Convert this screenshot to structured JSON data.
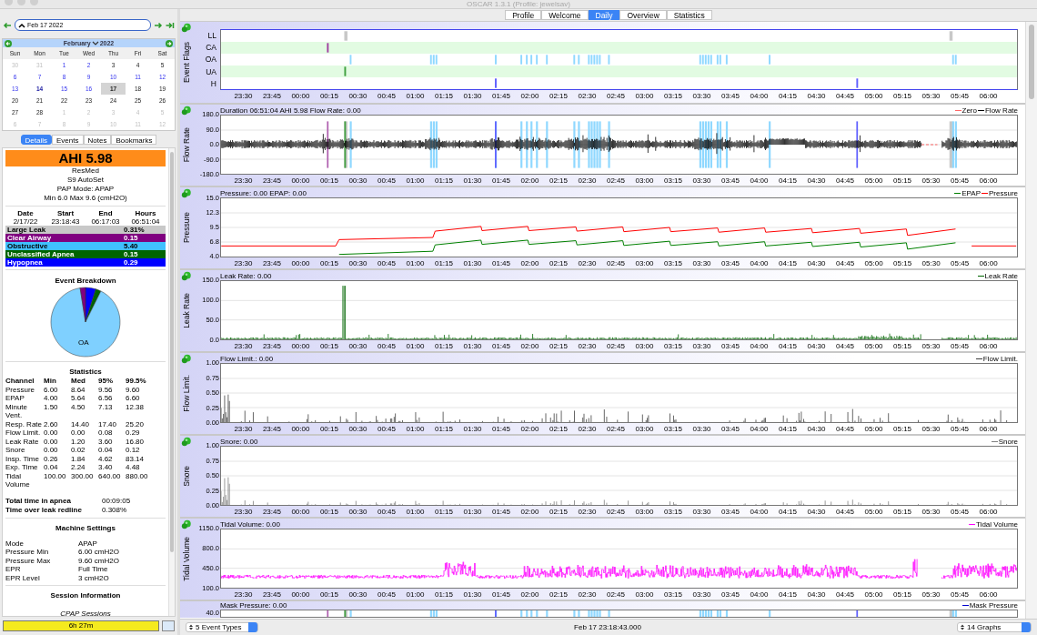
{
  "window": {
    "title": "OSCAR 1.3.1 (Profile: jewelsav)"
  },
  "date_field": {
    "value": "Feb 17 2022"
  },
  "calendar": {
    "month": "February",
    "year": "2022",
    "weekdays": [
      "Sun",
      "Mon",
      "Tue",
      "Wed",
      "Thu",
      "Fri",
      "Sat"
    ],
    "weeks": [
      [
        {
          "day": "30",
          "kind": "other",
          "selected": false
        },
        {
          "day": "31",
          "kind": "other",
          "selected": false
        },
        {
          "day": "1",
          "kind": "data",
          "selected": false
        },
        {
          "day": "2",
          "kind": "data",
          "selected": false
        },
        {
          "day": "3",
          "kind": "plain",
          "selected": false
        },
        {
          "day": "4",
          "kind": "plain",
          "selected": false
        },
        {
          "day": "5",
          "kind": "plain",
          "selected": false
        }
      ],
      [
        {
          "day": "6",
          "kind": "data",
          "selected": false
        },
        {
          "day": "7",
          "kind": "data",
          "selected": false
        },
        {
          "day": "8",
          "kind": "data",
          "selected": false
        },
        {
          "day": "9",
          "kind": "data",
          "selected": false
        },
        {
          "day": "10",
          "kind": "data",
          "selected": false
        },
        {
          "day": "11",
          "kind": "data",
          "selected": false
        },
        {
          "day": "12",
          "kind": "data",
          "selected": false
        }
      ],
      [
        {
          "day": "13",
          "kind": "data",
          "selected": false
        },
        {
          "day": "14",
          "kind": "today",
          "selected": false
        },
        {
          "day": "15",
          "kind": "data",
          "selected": false
        },
        {
          "day": "16",
          "kind": "data",
          "selected": false
        },
        {
          "day": "17",
          "kind": "plain",
          "selected": true
        },
        {
          "day": "18",
          "kind": "plain",
          "selected": false
        },
        {
          "day": "19",
          "kind": "plain",
          "selected": false
        }
      ],
      [
        {
          "day": "20",
          "kind": "plain",
          "selected": false
        },
        {
          "day": "21",
          "kind": "plain",
          "selected": false
        },
        {
          "day": "22",
          "kind": "plain",
          "selected": false
        },
        {
          "day": "23",
          "kind": "plain",
          "selected": false
        },
        {
          "day": "24",
          "kind": "plain",
          "selected": false
        },
        {
          "day": "25",
          "kind": "plain",
          "selected": false
        },
        {
          "day": "26",
          "kind": "plain",
          "selected": false
        }
      ],
      [
        {
          "day": "27",
          "kind": "plain",
          "selected": false
        },
        {
          "day": "28",
          "kind": "plain",
          "selected": false
        },
        {
          "day": "1",
          "kind": "other",
          "selected": false
        },
        {
          "day": "2",
          "kind": "other",
          "selected": false
        },
        {
          "day": "3",
          "kind": "other",
          "selected": false
        },
        {
          "day": "4",
          "kind": "other",
          "selected": false
        },
        {
          "day": "5",
          "kind": "other",
          "selected": false
        }
      ],
      [
        {
          "day": "6",
          "kind": "other",
          "selected": false
        },
        {
          "day": "7",
          "kind": "other",
          "selected": false
        },
        {
          "day": "8",
          "kind": "other",
          "selected": false
        },
        {
          "day": "9",
          "kind": "other",
          "selected": false
        },
        {
          "day": "10",
          "kind": "other",
          "selected": false
        },
        {
          "day": "11",
          "kind": "other",
          "selected": false
        },
        {
          "day": "12",
          "kind": "other",
          "selected": false
        }
      ]
    ]
  },
  "side_tabs": [
    {
      "label": "Details",
      "selected": true
    },
    {
      "label": "Events",
      "selected": false
    },
    {
      "label": "Notes",
      "selected": false
    },
    {
      "label": "Bookmarks",
      "selected": false
    }
  ],
  "summary": {
    "ahi": "AHI 5.98",
    "lines": [
      "ResMed",
      "S9 AutoSet",
      "PAP Mode: APAP",
      "Min 6.0 Max 9.6 (cmH2O)"
    ]
  },
  "session": {
    "headers": [
      "Date",
      "Start",
      "End",
      "Hours"
    ],
    "values": [
      "2/17/22",
      "23:18:43",
      "06:17:03",
      "06:51:04"
    ]
  },
  "events": [
    {
      "name": "Large Leak",
      "value": "0.31%",
      "color": "#c8c8c8",
      "kind": "leak"
    },
    {
      "name": "Clear Airway",
      "value": "0.15",
      "color": "#800080",
      "kind": "apnea"
    },
    {
      "name": "Obstructive",
      "value": "5.40",
      "color": "#40c0ff",
      "kind": "apnea"
    },
    {
      "name": "Unclassified Apnea",
      "value": "0.15",
      "color": "#006400",
      "kind": "apnea"
    },
    {
      "name": "Hypopnea",
      "value": "0.29",
      "color": "#0000ff",
      "kind": "apnea"
    }
  ],
  "breakdown": {
    "title": "Event Breakdown",
    "label": "OA"
  },
  "statistics": {
    "title": "Statistics",
    "columns": [
      "Channel",
      "Min",
      "Med",
      "95%",
      "99.5%"
    ],
    "rows": [
      [
        "Pressure",
        "6.00",
        "8.64",
        "9.56",
        "9.60"
      ],
      [
        "EPAP",
        "4.00",
        "5.64",
        "6.56",
        "6.60"
      ],
      [
        "Minute Vent.",
        "1.50",
        "4.50",
        "7.13",
        "12.38"
      ],
      [
        "Resp. Rate",
        "2.60",
        "14.40",
        "17.40",
        "25.20"
      ],
      [
        "Flow Limit.",
        "0.00",
        "0.00",
        "0.08",
        "0.29"
      ],
      [
        "Leak Rate",
        "0.00",
        "1.20",
        "3.60",
        "16.80"
      ],
      [
        "Snore",
        "0.00",
        "0.02",
        "0.04",
        "0.12"
      ],
      [
        "Insp. Time",
        "0.26",
        "1.84",
        "4.62",
        "83.14"
      ],
      [
        "Exp. Time",
        "0.04",
        "2.24",
        "3.40",
        "4.48"
      ],
      [
        "Tidal Volume",
        "100.00",
        "300.00",
        "640.00",
        "880.00"
      ]
    ]
  },
  "totals": [
    {
      "label": "Total time in apnea",
      "value": "00:09:05"
    },
    {
      "label": "Time over leak redline",
      "value": "0.308%"
    }
  ],
  "machine_settings": {
    "title": "Machine Settings",
    "rows": [
      {
        "label": "Mode",
        "value": "APAP"
      },
      {
        "label": "Pressure Min",
        "value": "6.00 cmH2O"
      },
      {
        "label": "Pressure Max",
        "value": "9.60 cmH2O"
      },
      {
        "label": "EPR",
        "value": "Full Time"
      },
      {
        "label": "EPR Level",
        "value": "3 cmH2O"
      }
    ]
  },
  "session_info": {
    "title": "Session Information",
    "subtitle": "CPAP Sessions"
  },
  "usage_bar": {
    "label": "6h 27m"
  },
  "main_tabs": [
    {
      "label": "Profile",
      "selected": false
    },
    {
      "label": "Welcome",
      "selected": false
    },
    {
      "label": "Daily",
      "selected": true
    },
    {
      "label": "Overview",
      "selected": false
    },
    {
      "label": "Statistics",
      "selected": false
    }
  ],
  "graphs": [
    {
      "kind": "flags",
      "ylabel": "Event Flags",
      "rows": [
        "LL",
        "CA",
        "OA",
        "UA",
        "H"
      ],
      "xticks": [
        "23:30",
        "23:45",
        "00:00",
        "00:15",
        "00:30",
        "00:45",
        "01:00",
        "01:15",
        "01:30",
        "01:45",
        "02:00",
        "02:15",
        "02:30",
        "02:45",
        "03:00",
        "03:15",
        "03:30",
        "03:45",
        "04:00",
        "04:15",
        "04:30",
        "04:45",
        "05:00",
        "05:15",
        "05:30",
        "05:45",
        "06:00"
      ]
    },
    {
      "kind": "flow",
      "ylabel": "Flow Rate",
      "title": "Duration 06:51:04 AHI 5.98 Flow Rate: 0.00",
      "legend": [
        {
          "label": "Zero",
          "color": "#ff6666"
        },
        {
          "label": "Flow Rate",
          "color": "#000000"
        }
      ],
      "yticks": [
        "180.0",
        "90.0",
        "0.0",
        "-90.0",
        "-180.0"
      ],
      "xticks": [
        "23:30",
        "23:45",
        "00:00",
        "00:15",
        "00:30",
        "00:45",
        "01:00",
        "01:15",
        "01:30",
        "01:45",
        "02:00",
        "02:15",
        "02:30",
        "02:45",
        "03:00",
        "03:15",
        "03:30",
        "03:45",
        "04:00",
        "04:15",
        "04:30",
        "04:45",
        "05:00",
        "05:15",
        "05:30",
        "05:45",
        "06:00"
      ]
    },
    {
      "kind": "pressure",
      "ylabel": "Pressure",
      "title": "Pressure: 0.00 EPAP: 0.00",
      "chart_data": {
        "type": "line",
        "grid": true,
        "legend": "top-right",
        "xlim": [
          -0.702,
          6.257
        ],
        "ylim": [
          4,
          15
        ],
        "xticks": [
          {
            "value": 0,
            "label": "00:00"
          },
          {
            "value": 0.25,
            "label": "00:15"
          },
          {
            "value": 0.5,
            "label": "00:30"
          },
          {
            "value": 0.75,
            "label": "00:45"
          },
          {
            "value": 1,
            "label": "01:00"
          },
          {
            "value": 1.25,
            "label": "01:15"
          },
          {
            "value": 1.5,
            "label": "01:30"
          },
          {
            "value": 1.75,
            "label": "01:45"
          },
          {
            "value": 2,
            "label": "02:00"
          },
          {
            "value": 2.25,
            "label": "02:15"
          },
          {
            "value": 2.5,
            "label": "02:30"
          },
          {
            "value": 2.75,
            "label": "02:45"
          },
          {
            "value": 3,
            "label": "03:00"
          },
          {
            "value": 3.25,
            "label": "03:15"
          },
          {
            "value": 3.5,
            "label": "03:30"
          },
          {
            "value": 3.75,
            "label": "03:45"
          },
          {
            "value": 4,
            "label": "04:00"
          },
          {
            "value": 4.25,
            "label": "04:15"
          },
          {
            "value": 4.5,
            "label": "04:30"
          },
          {
            "value": 4.75,
            "label": "04:45"
          },
          {
            "value": 5,
            "label": "05:00"
          },
          {
            "value": 5.25,
            "label": "05:15"
          },
          {
            "value": 5.5,
            "label": "05:30"
          },
          {
            "value": 5.75,
            "label": "05:45"
          },
          {
            "value": 6,
            "label": "06:00"
          }
        ],
        "yticks": [
          {
            "value": 15,
            "label": "15.0"
          },
          {
            "value": 12.25,
            "label": "12.3"
          },
          {
            "value": 9.5,
            "label": "9.5"
          },
          {
            "value": 6.75,
            "label": "6.8"
          },
          {
            "value": 4,
            "label": "4.0"
          }
        ],
        "x": [
          -0.7,
          0.3,
          0.33,
          1.15,
          1.17,
          1.57,
          1.58,
          1.98,
          1.99,
          2.4,
          2.41,
          2.81,
          2.82,
          3.22,
          3.23,
          3.64,
          3.65,
          4.05,
          4.06,
          4.46,
          4.47,
          4.88,
          4.89,
          5.29,
          5.3,
          5.72,
          5.79,
          5.86,
          6.25
        ],
        "series": [
          {
            "name": "EPAP",
            "color": "#008000",
            "values": [
              null,
              null,
              4.4,
              5.0,
              6.2,
              7.1,
              6.3,
              7.1,
              6.3,
              7.0,
              6.2,
              7.0,
              6.1,
              6.9,
              6.1,
              6.8,
              6.0,
              6.8,
              6.0,
              6.7,
              5.9,
              6.7,
              5.8,
              6.6,
              5.4,
              6.6,
              null,
              null,
              null
            ]
          },
          {
            "name": "Pressure",
            "color": "#ff0000",
            "values": [
              6.0,
              6.0,
              7.2,
              7.6,
              8.8,
              9.7,
              8.9,
              9.7,
              8.9,
              9.6,
              8.8,
              9.6,
              8.7,
              9.5,
              8.7,
              9.4,
              8.6,
              9.4,
              8.6,
              9.3,
              8.5,
              9.3,
              8.4,
              9.2,
              8.0,
              9.2,
              null,
              6.0,
              6.0
            ]
          }
        ]
      },
      "xticks": [
        "23:30",
        "23:45"
      ]
    },
    {
      "kind": "leak",
      "ylabel": "Leak Rate",
      "title": "Leak Rate: 0.00",
      "legend": [
        {
          "label": "Leak Rate",
          "color": "#006400"
        }
      ],
      "yticks": [
        "150.0",
        "100.0",
        "50.0",
        "0.0"
      ],
      "xticks": [
        "23:30",
        "23:45",
        "00:00",
        "00:15",
        "00:30",
        "00:45",
        "01:00",
        "01:15",
        "01:30",
        "01:45",
        "02:00",
        "02:15",
        "02:30",
        "02:45",
        "03:00",
        "03:15",
        "03:30",
        "03:45",
        "04:00",
        "04:15",
        "04:30",
        "04:45",
        "05:00",
        "05:15",
        "05:30",
        "05:45",
        "06:00"
      ]
    },
    {
      "kind": "flowlimit",
      "ylabel": "Flow Limit.",
      "title": "Flow Limit.: 0.00",
      "legend": [
        {
          "label": "Flow Limit.",
          "color": "#404040"
        }
      ],
      "yticks": [
        "1.00",
        "0.75",
        "0.50",
        "0.25",
        "0.00"
      ],
      "xticks": [
        "23:30",
        "23:45",
        "00:00",
        "00:15",
        "00:30",
        "00:45",
        "01:00",
        "01:15",
        "01:30",
        "01:45",
        "02:00",
        "02:15",
        "02:30",
        "02:45",
        "03:00",
        "03:15",
        "03:30",
        "03:45",
        "04:00",
        "04:15",
        "04:30",
        "04:45",
        "05:00",
        "05:15",
        "05:30",
        "05:45",
        "06:00"
      ]
    },
    {
      "kind": "snore",
      "ylabel": "Snore",
      "title": "Snore: 0.00",
      "legend": [
        {
          "label": "Snore",
          "color": "#808080"
        }
      ],
      "yticks": [
        "1.00",
        "0.75",
        "0.50",
        "0.25",
        "0.00"
      ],
      "xticks": [
        "23:30",
        "23:45",
        "00:00",
        "00:15",
        "00:30",
        "00:45",
        "01:00",
        "01:15",
        "01:30",
        "01:45",
        "02:00",
        "02:15",
        "02:30",
        "02:45",
        "03:00",
        "03:15",
        "03:30",
        "03:45",
        "04:00",
        "04:15",
        "04:30",
        "04:45",
        "05:00",
        "05:15",
        "05:30",
        "05:45",
        "06:00"
      ]
    },
    {
      "kind": "tidal",
      "ylabel": "Tidal Volume",
      "title": "Tidal Volume: 0.00",
      "legend": [
        {
          "label": "Tidal Volume",
          "color": "#ff00ff"
        }
      ],
      "yticks": [
        "1150.0",
        "800.0",
        "450.0",
        "100.0"
      ],
      "xticks": [
        "23:30",
        "23:45",
        "00:00",
        "00:15",
        "00:30",
        "00:45",
        "01:00",
        "01:15",
        "01:30",
        "01:45",
        "02:00",
        "02:15",
        "02:30",
        "02:45",
        "03:00",
        "03:15",
        "03:30",
        "03:45",
        "04:00",
        "04:15",
        "04:30",
        "04:45",
        "05:00",
        "05:15",
        "05:30",
        "05:45",
        "06:00"
      ]
    },
    {
      "kind": "mask",
      "title": "Mask Pressure: 0.00",
      "legend": [
        {
          "label": "Mask Pressure",
          "color": "#0000cc"
        }
      ],
      "yticks": [
        "40.0"
      ]
    }
  ],
  "bottom_bar": {
    "event_types": "5 Event Types",
    "timestamp": "Feb 17 23:18:43.000",
    "graphs": "14 Graphs"
  }
}
